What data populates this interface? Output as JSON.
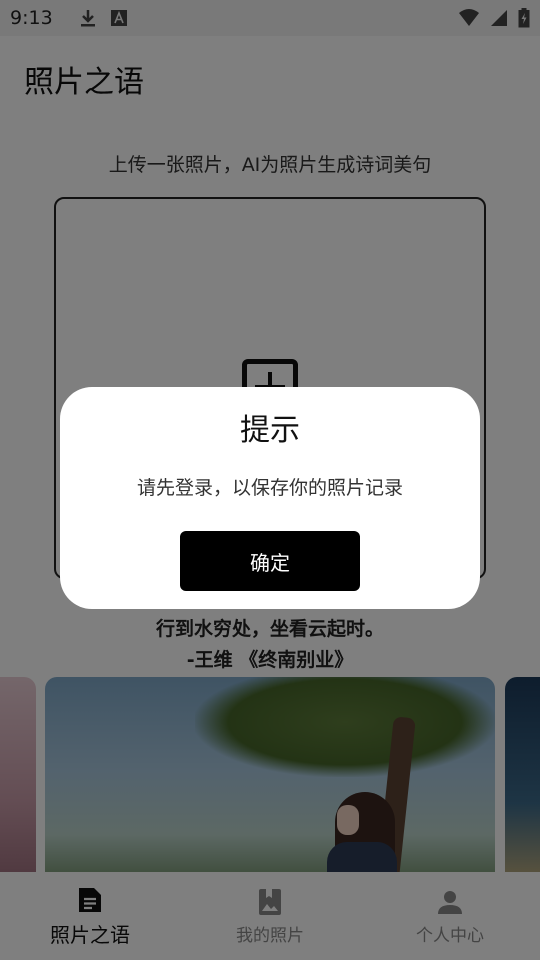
{
  "status_bar": {
    "time": "9:13",
    "icons": [
      "download-icon",
      "text-a-icon",
      "wifi-icon",
      "signal-icon",
      "battery-charging-icon"
    ]
  },
  "app_bar": {
    "title": "照片之语"
  },
  "upload": {
    "hint": "上传一张照片，AI为照片生成诗词美句",
    "icon": "add-box-icon"
  },
  "poem": {
    "line": "行到水穷处，坐看云起时。",
    "author": "-王维 《终南别业》"
  },
  "bottom_nav": {
    "items": [
      {
        "label": "照片之语",
        "icon": "document-icon",
        "active": true
      },
      {
        "label": "我的照片",
        "icon": "photo-album-icon",
        "active": false
      },
      {
        "label": "个人中心",
        "icon": "person-icon",
        "active": false
      }
    ]
  },
  "dialog": {
    "title": "提示",
    "message": "请先登录，以保存你的照片记录",
    "confirm_label": "确定"
  }
}
